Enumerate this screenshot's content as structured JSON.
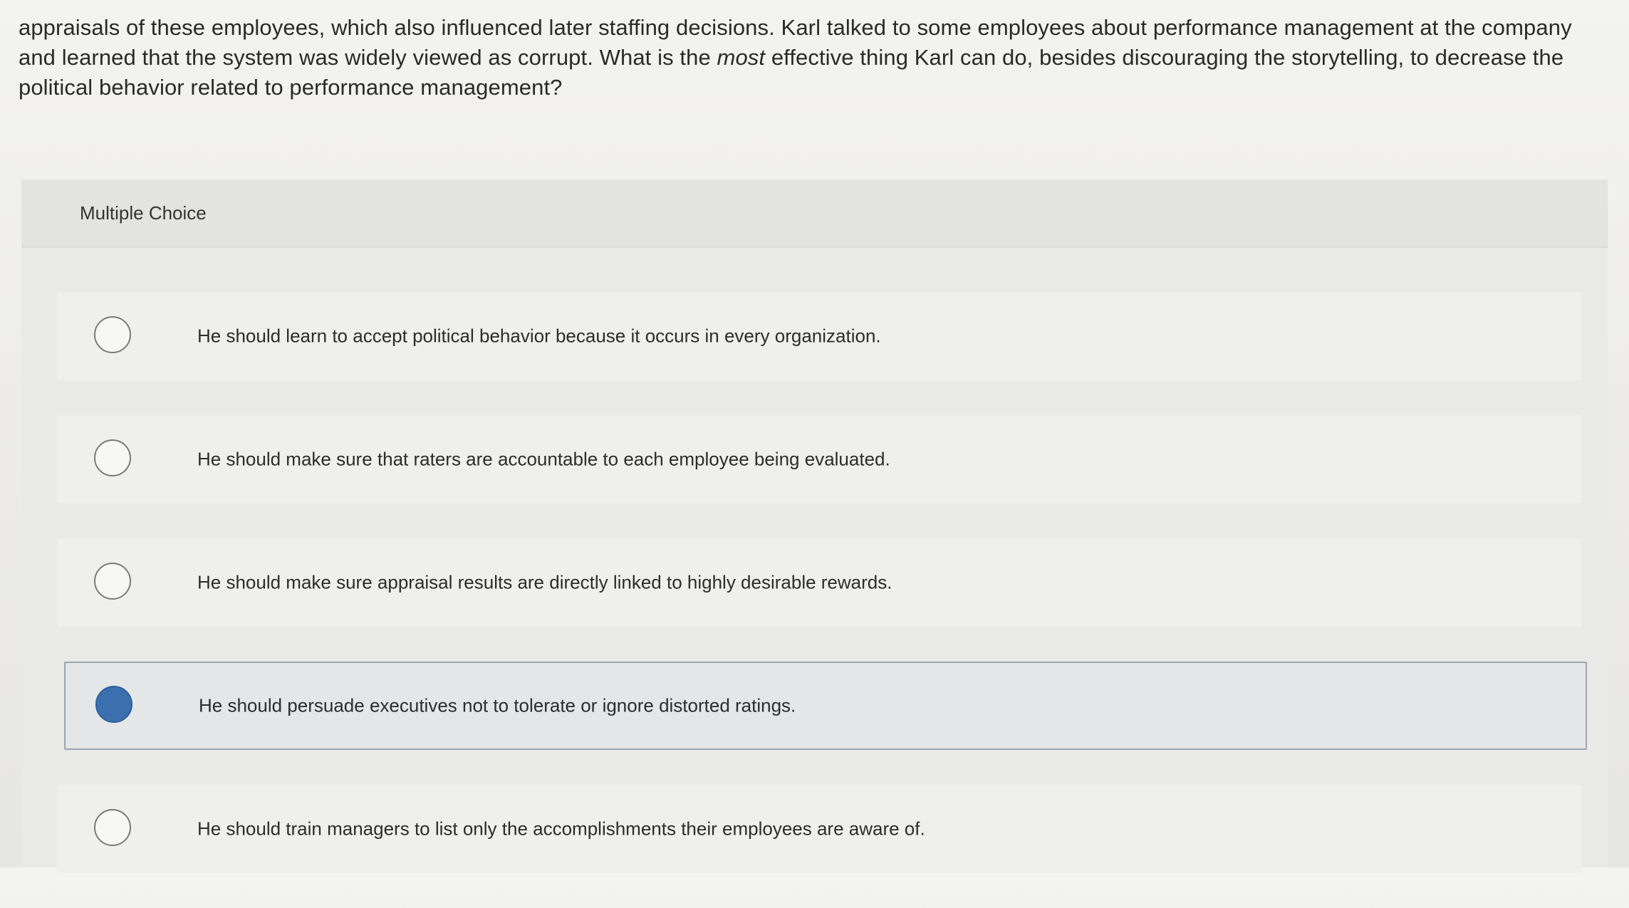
{
  "question": {
    "text_before": "appraisals of these employees, which also influenced later staffing decisions. Karl talked to some employees about performance management at the company and learned that the system was widely viewed as corrupt. What is the ",
    "emphasis": "most",
    "text_after": " effective thing Karl can do, besides discouraging the storytelling, to decrease the political behavior related to performance management?"
  },
  "panel": {
    "title": "Multiple Choice"
  },
  "options": [
    {
      "label": "He should learn to accept political behavior because it occurs in every organization.",
      "selected": false
    },
    {
      "label": "He should make sure that raters are accountable to each employee being evaluated.",
      "selected": false
    },
    {
      "label": "He should make sure appraisal results are directly linked to highly desirable rewards.",
      "selected": false
    },
    {
      "label": "He should persuade executives not to tolerate or ignore distorted ratings.",
      "selected": true
    },
    {
      "label": "He should train managers to list only the accomplishments their employees are aware of.",
      "selected": false
    }
  ],
  "colors": {
    "selected_radio": "#3b6fae",
    "selected_border": "#9aa6b2"
  }
}
